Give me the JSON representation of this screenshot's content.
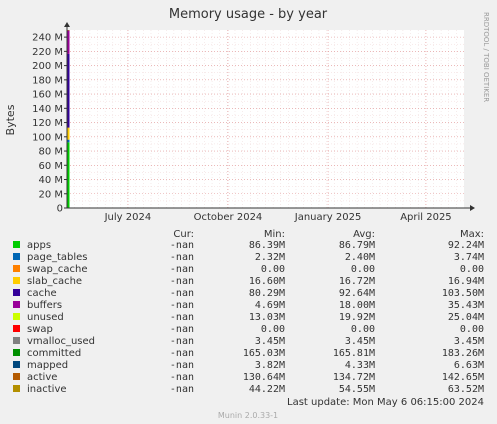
{
  "chart_data": {
    "type": "area",
    "title": "Memory usage - by year",
    "ylabel": "Bytes",
    "side_text": "RRDTOOL / TOBI OETIKER",
    "ylim": [
      0,
      250000000
    ],
    "y_ticks": [
      {
        "value": 0,
        "label": "0"
      },
      {
        "value": 20000000,
        "label": "20 M"
      },
      {
        "value": 40000000,
        "label": "40 M"
      },
      {
        "value": 60000000,
        "label": "60 M"
      },
      {
        "value": 80000000,
        "label": "80 M"
      },
      {
        "value": 100000000,
        "label": "100 M"
      },
      {
        "value": 120000000,
        "label": "120 M"
      },
      {
        "value": 140000000,
        "label": "140 M"
      },
      {
        "value": 160000000,
        "label": "160 M"
      },
      {
        "value": 180000000,
        "label": "180 M"
      },
      {
        "value": 200000000,
        "label": "200 M"
      },
      {
        "value": 220000000,
        "label": "220 M"
      },
      {
        "value": 240000000,
        "label": "240 M"
      }
    ],
    "x_ticks": [
      {
        "value": "2024-07-01",
        "label": "July 2024"
      },
      {
        "value": "2024-10-01",
        "label": "October 2024"
      },
      {
        "value": "2025-01-01",
        "label": "January 2025"
      },
      {
        "value": "2025-04-01",
        "label": "April 2025"
      }
    ],
    "xlim": [
      "2024-05-06",
      "2025-05-06"
    ],
    "grid": true,
    "legend_headers": {
      "cur": "Cur:",
      "min": "Min:",
      "avg": "Avg:",
      "max": "Max:"
    },
    "series": [
      {
        "name": "apps",
        "color": "#00cc00",
        "cur": "-nan",
        "min": "86.39M",
        "avg": "86.79M",
        "max": "92.24M",
        "value": 92240000
      },
      {
        "name": "page_tables",
        "color": "#0066b3",
        "cur": "-nan",
        "min": "2.32M",
        "avg": "2.40M",
        "max": "3.74M",
        "value": 3740000
      },
      {
        "name": "swap_cache",
        "color": "#ff8000",
        "cur": "-nan",
        "min": "0.00",
        "avg": "0.00",
        "max": "0.00",
        "value": 0
      },
      {
        "name": "slab_cache",
        "color": "#ffcc00",
        "cur": "-nan",
        "min": "16.60M",
        "avg": "16.72M",
        "max": "16.94M",
        "value": 16940000
      },
      {
        "name": "cache",
        "color": "#330099",
        "cur": "-nan",
        "min": "80.29M",
        "avg": "92.64M",
        "max": "103.50M",
        "value": 103500000
      },
      {
        "name": "buffers",
        "color": "#990099",
        "cur": "-nan",
        "min": "4.69M",
        "avg": "18.00M",
        "max": "35.43M",
        "value": 35430000
      },
      {
        "name": "unused",
        "color": "#ccff00",
        "cur": "-nan",
        "min": "13.03M",
        "avg": "19.92M",
        "max": "25.04M",
        "value": 25040000
      },
      {
        "name": "swap",
        "color": "#ff0000",
        "cur": "-nan",
        "min": "0.00",
        "avg": "0.00",
        "max": "0.00",
        "value": 0
      },
      {
        "name": "vmalloc_used",
        "color": "#808080",
        "cur": "-nan",
        "min": "3.45M",
        "avg": "3.45M",
        "max": "3.45M",
        "value": 3450000
      },
      {
        "name": "committed",
        "color": "#008f00",
        "cur": "-nan",
        "min": "165.03M",
        "avg": "165.81M",
        "max": "183.26M",
        "value": 183260000
      },
      {
        "name": "mapped",
        "color": "#00487d",
        "cur": "-nan",
        "min": "3.82M",
        "avg": "4.33M",
        "max": "6.63M",
        "value": 6630000
      },
      {
        "name": "active",
        "color": "#b35a00",
        "cur": "-nan",
        "min": "130.64M",
        "avg": "134.72M",
        "max": "142.65M",
        "value": 142650000
      },
      {
        "name": "inactive",
        "color": "#b38f00",
        "cur": "-nan",
        "min": "44.22M",
        "avg": "54.55M",
        "max": "63.52M",
        "value": 63520000
      }
    ],
    "last_update": "Last update:  Mon May  6 06:15:00 2024",
    "footer": "Munin 2.0.33-1"
  }
}
